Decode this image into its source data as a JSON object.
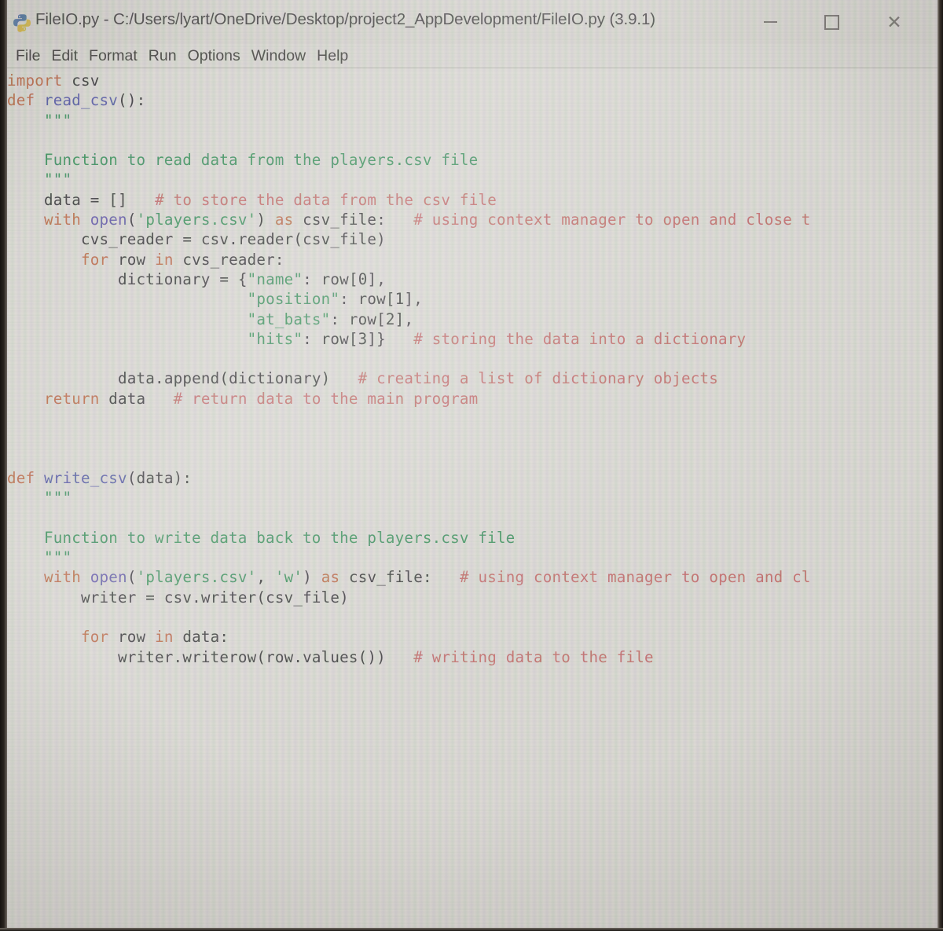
{
  "window": {
    "app": "IDLE",
    "title": "FileIO.py - C:/Users/lyart/OneDrive/Desktop/project2_AppDevelopment/FileIO.py (3.9.1)",
    "icon": "python-logo-icon",
    "controls": {
      "minimize": "—",
      "maximize": "□",
      "close": "✕"
    }
  },
  "menubar": {
    "items": [
      {
        "label": "File"
      },
      {
        "label": "Edit"
      },
      {
        "label": "Format"
      },
      {
        "label": "Run"
      },
      {
        "label": "Options"
      },
      {
        "label": "Window"
      },
      {
        "label": "Help"
      }
    ]
  },
  "editor": {
    "language": "python",
    "colors": {
      "background": "#d9d7d0",
      "keyword": "#b8613b",
      "definition": "#4a4f9e",
      "string": "#2f8a52",
      "comment": "#c0625f",
      "builtin": "#5a4fa3",
      "text": "#2d2d2d"
    },
    "lines": [
      "import csv",
      "def read_csv():",
      "    \"\"\"",
      "",
      "    Function to read data from the players.csv file",
      "    \"\"\"",
      "    data = []   # to store the data from the csv file",
      "    with open('players.csv') as csv_file:   # using context manager to open and close t",
      "        cvs_reader = csv.reader(csv_file)",
      "        for row in cvs_reader:",
      "            dictionary = {\"name\": row[0],",
      "                          \"position\": row[1],",
      "                          \"at_bats\": row[2],",
      "                          \"hits\": row[3]}   # storing the data into a dictionary",
      "",
      "            data.append(dictionary)   # creating a list of dictionary objects",
      "    return data   # return data to the main program",
      "",
      "",
      "",
      "def write_csv(data):",
      "    \"\"\"",
      "",
      "    Function to write data back to the players.csv file",
      "    \"\"\"",
      "    with open('players.csv', 'w') as csv_file:   # using context manager to open and cl",
      "        writer = csv.writer(csv_file)",
      "",
      "        for row in data:",
      "            writer.writerow(row.values())   # writing data to the file"
    ]
  }
}
